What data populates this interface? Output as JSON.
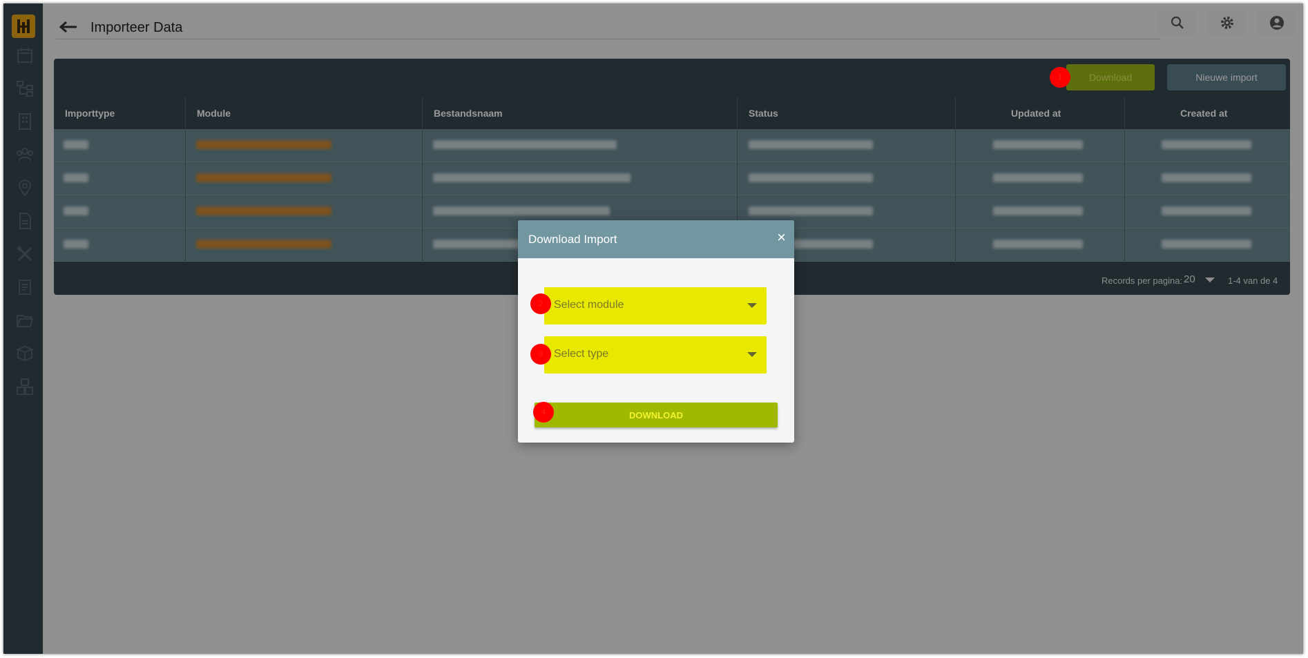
{
  "app": {
    "page_title": "Importeer Data"
  },
  "sidebar": {
    "icons": [
      "calendar-icon",
      "hierarchy-icon",
      "building-icon",
      "group-icon",
      "location-pin-icon",
      "document-icon",
      "tools-icon",
      "report-icon",
      "folder-open-icon",
      "box-icon",
      "boxes-icon"
    ]
  },
  "toolbar": {
    "download_label": "Download",
    "new_import_label": "Nieuwe import"
  },
  "table": {
    "columns": [
      "Importtype",
      "Module",
      "Bestandsnaam",
      "Status",
      "Updated at",
      "Created at"
    ],
    "rows_count_visible": 4
  },
  "pagination": {
    "records_label": "Records per pagina:",
    "per_page": "20",
    "range": "1-4 van de 4"
  },
  "modal": {
    "title": "Download Import",
    "close": "×",
    "module_placeholder": "Select module",
    "type_placeholder": "Select type",
    "download_label": "DOWNLOAD"
  },
  "markers": [
    "1",
    "2",
    "3",
    "4"
  ],
  "colors": {
    "sidebar": "#37474f",
    "accent_green": "#9cbb17",
    "highlight_yellow": "#e8e800",
    "modal_header": "#7397a0",
    "marker_red": "#ff0000"
  }
}
